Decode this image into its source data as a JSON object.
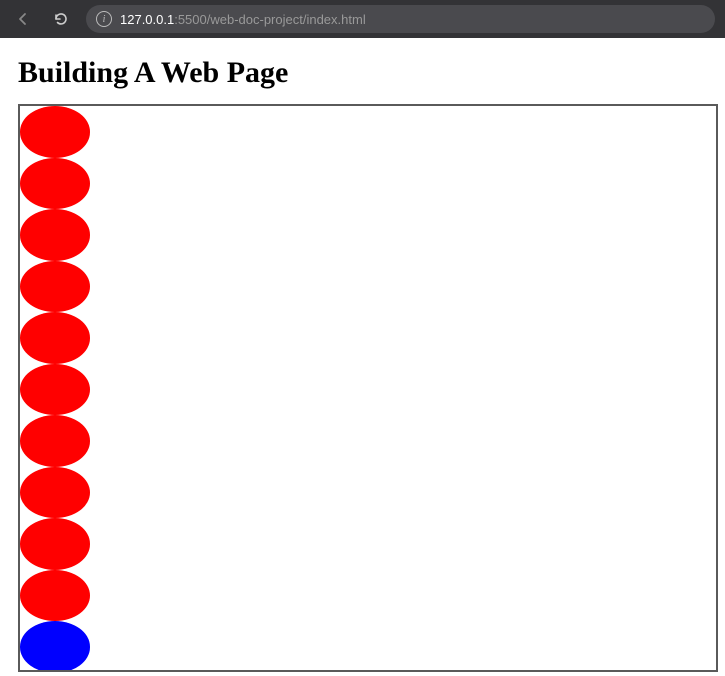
{
  "browser": {
    "url_host": "127.0.0.1",
    "url_path": ":5500/web-doc-project/index.html"
  },
  "page": {
    "title": "Building A Web Page"
  },
  "shapes": {
    "items": [
      {
        "color": "#ff0000"
      },
      {
        "color": "#ff0000"
      },
      {
        "color": "#ff0000"
      },
      {
        "color": "#ff0000"
      },
      {
        "color": "#ff0000"
      },
      {
        "color": "#ff0000"
      },
      {
        "color": "#ff0000"
      },
      {
        "color": "#ff0000"
      },
      {
        "color": "#ff0000"
      },
      {
        "color": "#ff0000"
      },
      {
        "color": "#0000ff"
      }
    ]
  }
}
